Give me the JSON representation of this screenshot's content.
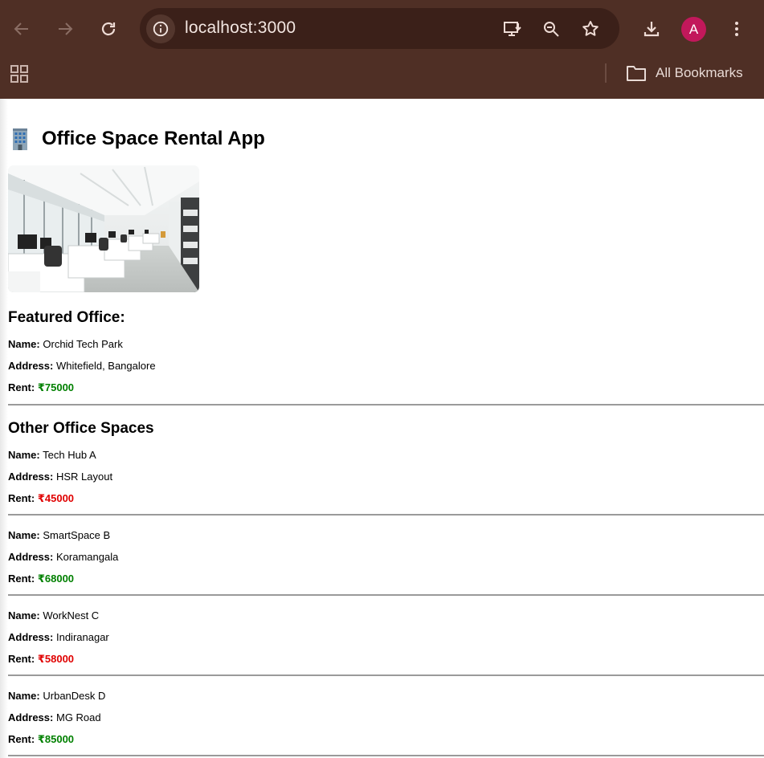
{
  "browser": {
    "url": "localhost:3000",
    "profile_initial": "A",
    "bookmarks_label": "All Bookmarks",
    "icons": [
      "back-icon",
      "forward-icon",
      "reload-icon",
      "site-info-icon",
      "install-app-icon",
      "zoom-icon",
      "star-icon",
      "download-icon",
      "menu-icon",
      "apps-icon",
      "folder-icon"
    ],
    "colors": {
      "frame": "#4f2f25",
      "omnibox": "#3b2019",
      "avatar": "#c2185b"
    }
  },
  "app": {
    "title": "Office Space Rental App",
    "title_icon": "office-building-icon",
    "image_alt": "office-photo",
    "featured": {
      "heading": "Featured Office:",
      "name_label": "Name:",
      "name": "Orchid Tech Park",
      "address_label": "Address:",
      "address": "Whitefield, Bangalore",
      "rent_label": "Rent:",
      "rent": "₹75000",
      "rent_color": "#008000"
    },
    "others_heading": "Other Office Spaces",
    "labels": {
      "name": "Name:",
      "address": "Address:",
      "rent": "Rent:"
    },
    "offices": [
      {
        "name": "Tech Hub A",
        "address": "HSR Layout",
        "rent": "₹45000",
        "rent_color": "#e00000"
      },
      {
        "name": "SmartSpace B",
        "address": "Koramangala",
        "rent": "₹68000",
        "rent_color": "#008000"
      },
      {
        "name": "WorkNest C",
        "address": "Indiranagar",
        "rent": "₹58000",
        "rent_color": "#e00000"
      },
      {
        "name": "UrbanDesk D",
        "address": "MG Road",
        "rent": "₹85000",
        "rent_color": "#008000"
      }
    ]
  }
}
